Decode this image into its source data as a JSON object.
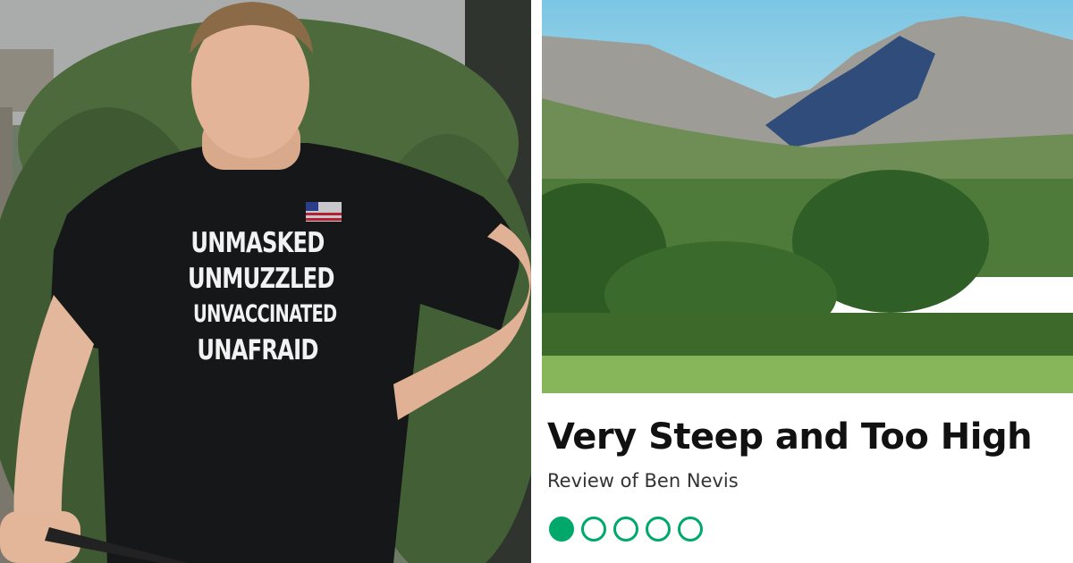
{
  "left_photo": {
    "shirt_lines": [
      "UNMASKED",
      "UNMUZZLED",
      "UNVACCINATED",
      "UNAFRAID"
    ]
  },
  "right_card": {
    "title": "Very Steep and Too High",
    "subtitle": "Review of Ben Nevis",
    "rating": {
      "value": 1,
      "max": 5,
      "color": "#00a86b"
    }
  }
}
